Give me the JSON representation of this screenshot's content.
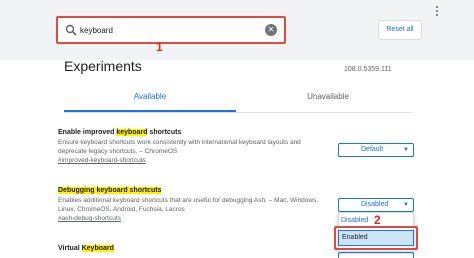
{
  "search": {
    "value": "keyboard",
    "annotation": "1"
  },
  "toolbar": {
    "reset_label": "Reset all"
  },
  "page": {
    "title": "Experiments",
    "version": "108.0.5359.111"
  },
  "tabs": [
    {
      "label": "Available"
    },
    {
      "label": "Unavailable"
    }
  ],
  "experiments": [
    {
      "title_pre": "Enable improved ",
      "title_hl": "keyboard",
      "title_post": " shortcuts",
      "desc": "Ensure keyboard shortcuts work consistently with international keyboard layouts and deprecate legacy shortcuts. – ChromeOS",
      "link": "#improved-keyboard-shortcuts",
      "select": "Default"
    },
    {
      "title_hl": "Debugging keyboard shortcuts",
      "desc": "Enables additional keyboard shortcuts that are useful for debugging Ash. – Mac, Windows, Linux, ChromeOS, Android, Fuchsia, Lacros",
      "link": "#ash-debug-shortcuts",
      "select": "Disabled",
      "options": [
        "Disabled",
        "Enabled"
      ],
      "annotation": "2"
    },
    {
      "title_pre": "Virtual ",
      "title_hl": "Keyboard"
    }
  ]
}
